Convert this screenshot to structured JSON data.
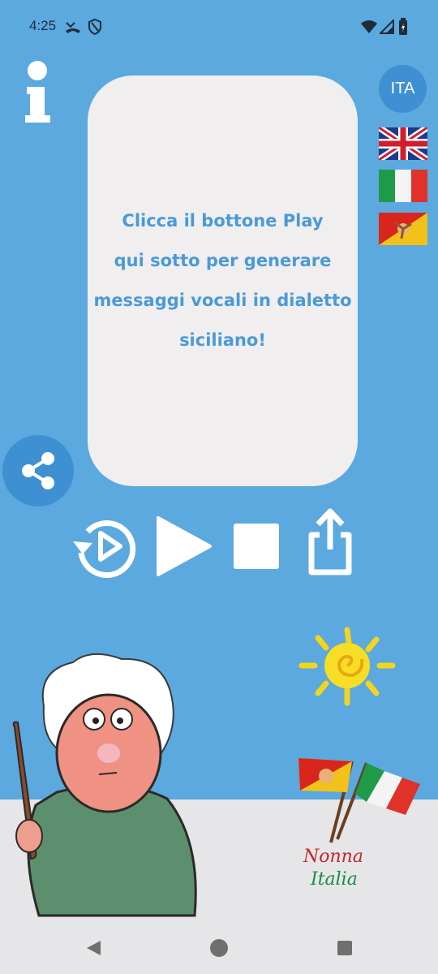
{
  "status_bar": {
    "time": "4:25",
    "icons": [
      "missed-call-icon",
      "shield-icon",
      "wifi-icon",
      "signal-icon",
      "battery-icon"
    ]
  },
  "info_button": {
    "icon": "info-icon"
  },
  "message": {
    "lines": [
      "Clicca il bottone Play",
      "qui sotto per generare",
      "messaggi vocali in dialetto",
      "siciliano!"
    ],
    "color": "#4A9AD6"
  },
  "language": {
    "current": "ITA",
    "flags": [
      "uk-flag",
      "italy-flag",
      "sicily-flag"
    ]
  },
  "controls": {
    "icons": [
      "replay-icon",
      "play-icon",
      "stop-icon",
      "export-icon"
    ]
  },
  "share_button": {
    "icon": "share-icon"
  },
  "logo": {
    "line1": "Nonna",
    "line2": "Italia"
  },
  "colors": {
    "sky": "#5BA9DF",
    "card": "#F0EEEF",
    "accent": "#3F8FD3"
  },
  "nav_bar": {
    "icons": [
      "back-icon",
      "home-icon",
      "recents-icon"
    ]
  }
}
